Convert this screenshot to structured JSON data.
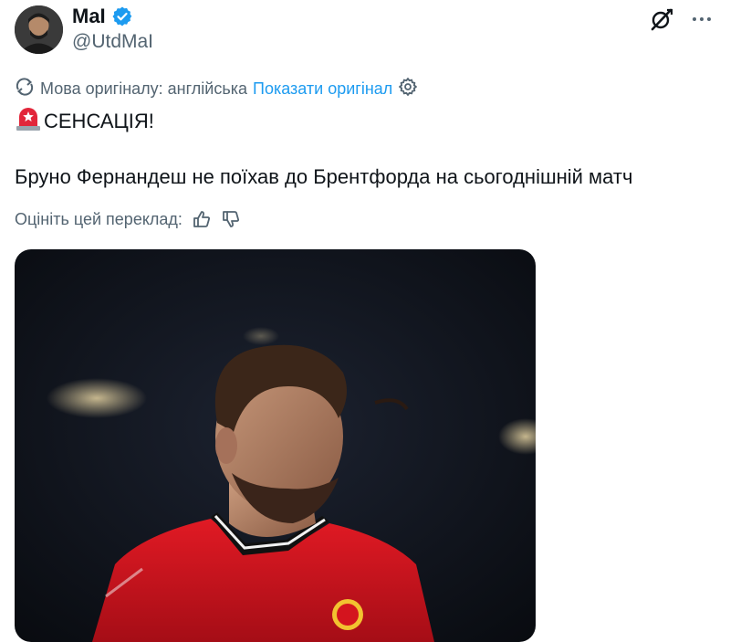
{
  "author": {
    "name": "MaI",
    "handle": "@UtdMaI",
    "verified": true
  },
  "translation": {
    "language_note": "Мова оригіналу: англійська",
    "show_original": "Показати оригінал"
  },
  "tweet": {
    "emoji": "siren-icon",
    "headline": "СЕНСАЦІЯ!",
    "body": "Бруно Фернандеш не поїхав до Брентфорда на сьогоднішній матч"
  },
  "rate": {
    "label": "Оцініть цей переклад:"
  },
  "colors": {
    "link": "#1d9bf0",
    "secondary_text": "#536471",
    "verified_badge": "#1d9bf0",
    "jersey_red": "#d4141e"
  }
}
